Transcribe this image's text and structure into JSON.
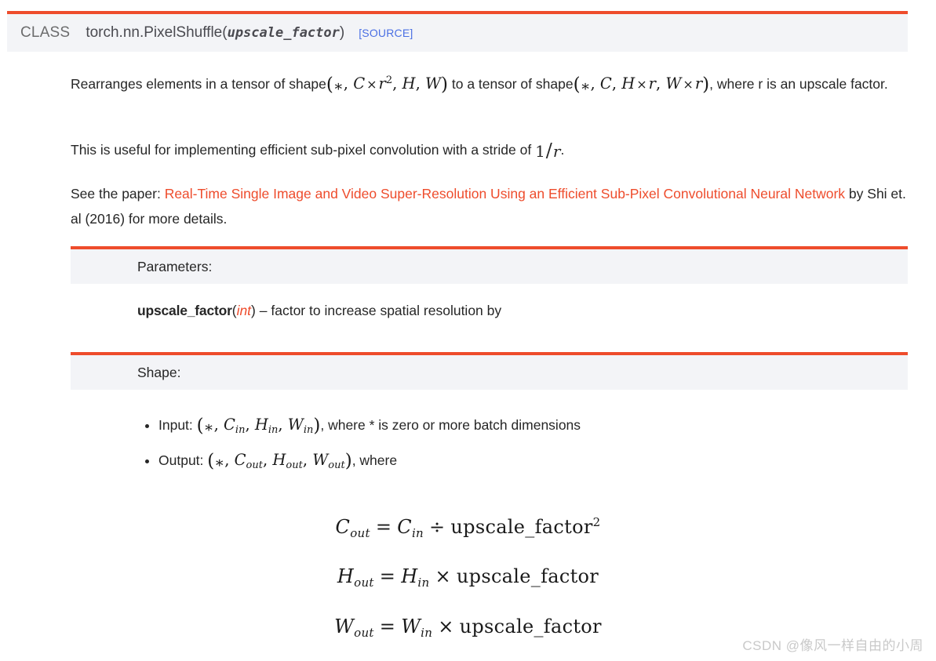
{
  "signature": {
    "class_keyword": "CLASS",
    "qualified_name": "torch.nn.PixelShuffle",
    "open_paren": "(",
    "parameter": "upscale_factor",
    "close_paren": ")",
    "source_link": "[SOURCE]",
    "source_link_color": "#4a6fe3",
    "accent_color": "#ee4c2c",
    "box_background": "#f3f4f7"
  },
  "description": {
    "p1": {
      "lead": "Rearranges elements in a tensor of shape",
      "shape_in": "(*, C × r², H, W)",
      "middle": "to a tensor of shape",
      "shape_out": "(*, C, H × r, W × r)",
      "tail": ", where r is an upscale factor."
    },
    "p2": {
      "lead": "This is useful for implementing efficient sub-pixel convolution with a stride of",
      "stride": "1/r",
      "tail": "."
    },
    "p3": {
      "lead": "See the paper:",
      "link_text": "Real-Time Single Image and Video Super-Resolution Using an Efficient Sub-Pixel Convolutional Neural Network",
      "link_color": "#ee4c2c",
      "tail": "by Shi et. al (2016) for more details."
    }
  },
  "parameters_section": {
    "heading": "Parameters:",
    "entry": {
      "name": "upscale_factor",
      "open_paren": "(",
      "type": "int",
      "close_paren": ")",
      "dash": "–",
      "description": "factor to increase spatial resolution by"
    }
  },
  "shape_section": {
    "heading": "Shape:",
    "items": [
      {
        "label": "Input:",
        "expr": "(*, C_in, H_in, W_in)",
        "note": ", where * is zero or more batch dimensions"
      },
      {
        "label": "Output:",
        "expr": "(*, C_out, H_out, W_out)",
        "note": ", where"
      }
    ]
  },
  "equations": [
    {
      "lhs": "C_out",
      "relation": "=",
      "rhs": "C_in ÷ upscale_factor²",
      "plain": "C_out = C_in ÷ upscale_factor^2"
    },
    {
      "lhs": "H_out",
      "relation": "=",
      "rhs": "H_in × upscale_factor",
      "plain": "H_out = H_in × upscale_factor"
    },
    {
      "lhs": "W_out",
      "relation": "=",
      "rhs": "W_in × upscale_factor",
      "plain": "W_out = W_in × upscale_factor"
    }
  ],
  "watermark": {
    "text": "CSDN @像风一样自由的小周"
  }
}
